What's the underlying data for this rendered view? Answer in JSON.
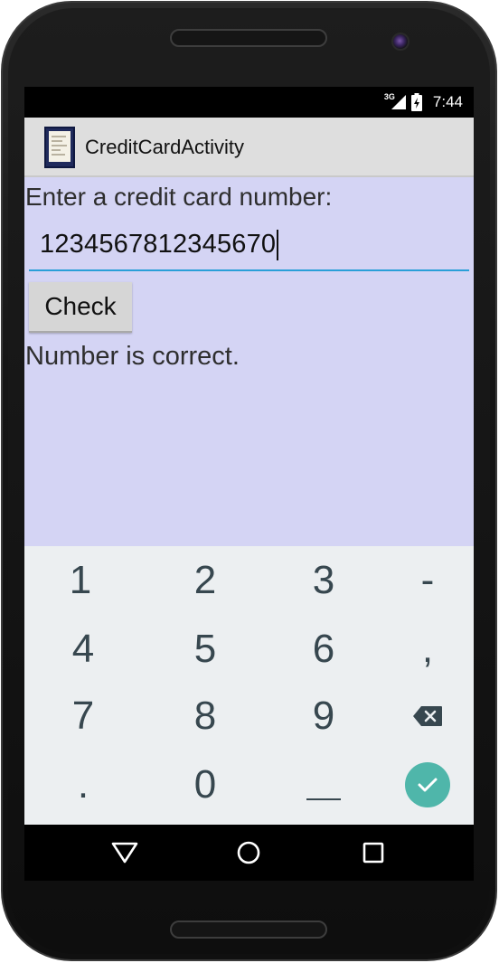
{
  "statusbar": {
    "network": "3G",
    "time": "7:44",
    "icons": [
      "signal-icon",
      "battery-icon"
    ]
  },
  "app": {
    "title": "CreditCardActivity",
    "icon": "app-icon"
  },
  "form": {
    "prompt": "Enter a credit card number:",
    "card_number": "1234567812345670",
    "check_label": "Check",
    "result": "Number is correct."
  },
  "keyboard": {
    "rows": [
      [
        "1",
        "2",
        "3",
        "-"
      ],
      [
        "4",
        "5",
        "6",
        ","
      ],
      [
        "7",
        "8",
        "9",
        "backspace-icon"
      ],
      [
        ".",
        "0",
        "_",
        "enter-check-icon"
      ]
    ]
  },
  "navbar": {
    "buttons": [
      "back-icon",
      "home-icon",
      "recents-icon"
    ]
  },
  "colors": {
    "content_bg": "#d4d4f4",
    "actionbar_bg": "#dedede",
    "input_underline": "#2a9fd8",
    "keyboard_bg": "#eceff1",
    "enter_key": "#4fb6aa",
    "key_text": "#37474f"
  }
}
